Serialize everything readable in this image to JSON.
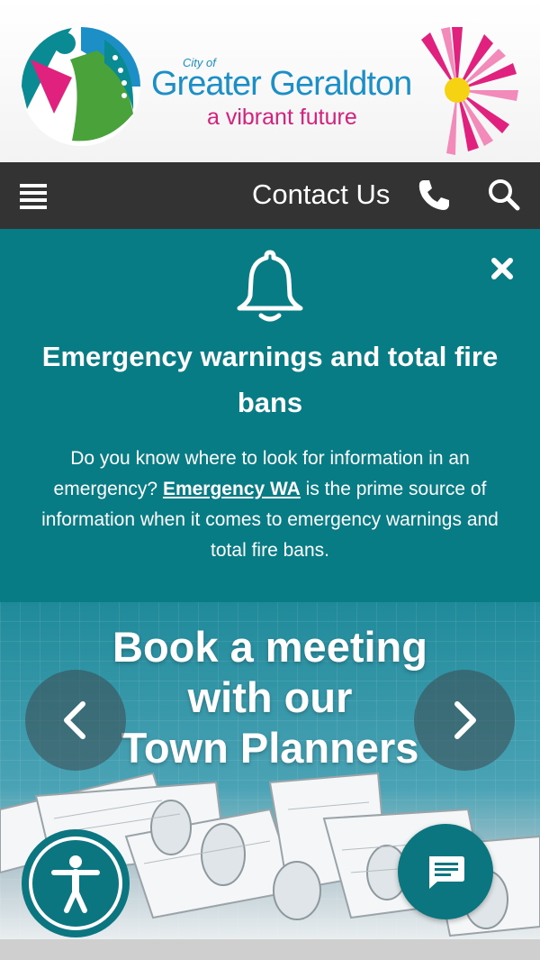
{
  "header": {
    "logo_cityof": "City of",
    "logo_name": "Greater Geraldton",
    "logo_tagline": "a vibrant future"
  },
  "nav": {
    "menu_icon": "hamburger-icon",
    "contact_label": "Contact Us",
    "phone_icon": "phone-icon",
    "search_icon": "search-icon"
  },
  "alert": {
    "icon": "bell-icon",
    "close_icon": "close-icon",
    "title": "Emergency warnings and total fire bans",
    "body_before": "Do you know where to look for information in an emergency? ",
    "link_text": "Emergency WA",
    "body_after": " is the prime source of information when it comes to emergency warnings and total fire bans."
  },
  "banner": {
    "heading_line1": "Book a meeting",
    "heading_line2": "with our",
    "heading_line3": "Town Planners",
    "prev_icon": "chevron-left-icon",
    "next_icon": "chevron-right-icon"
  },
  "floating": {
    "accessibility_icon": "accessibility-icon",
    "chat_icon": "chat-icon"
  },
  "colors": {
    "header_bg": "#f6f6f6",
    "nav_bg": "#333333",
    "alert_bg": "#087c85",
    "brand_blue": "#1c8fc6",
    "brand_pink": "#d4217d",
    "button_teal": "#0b7680"
  }
}
